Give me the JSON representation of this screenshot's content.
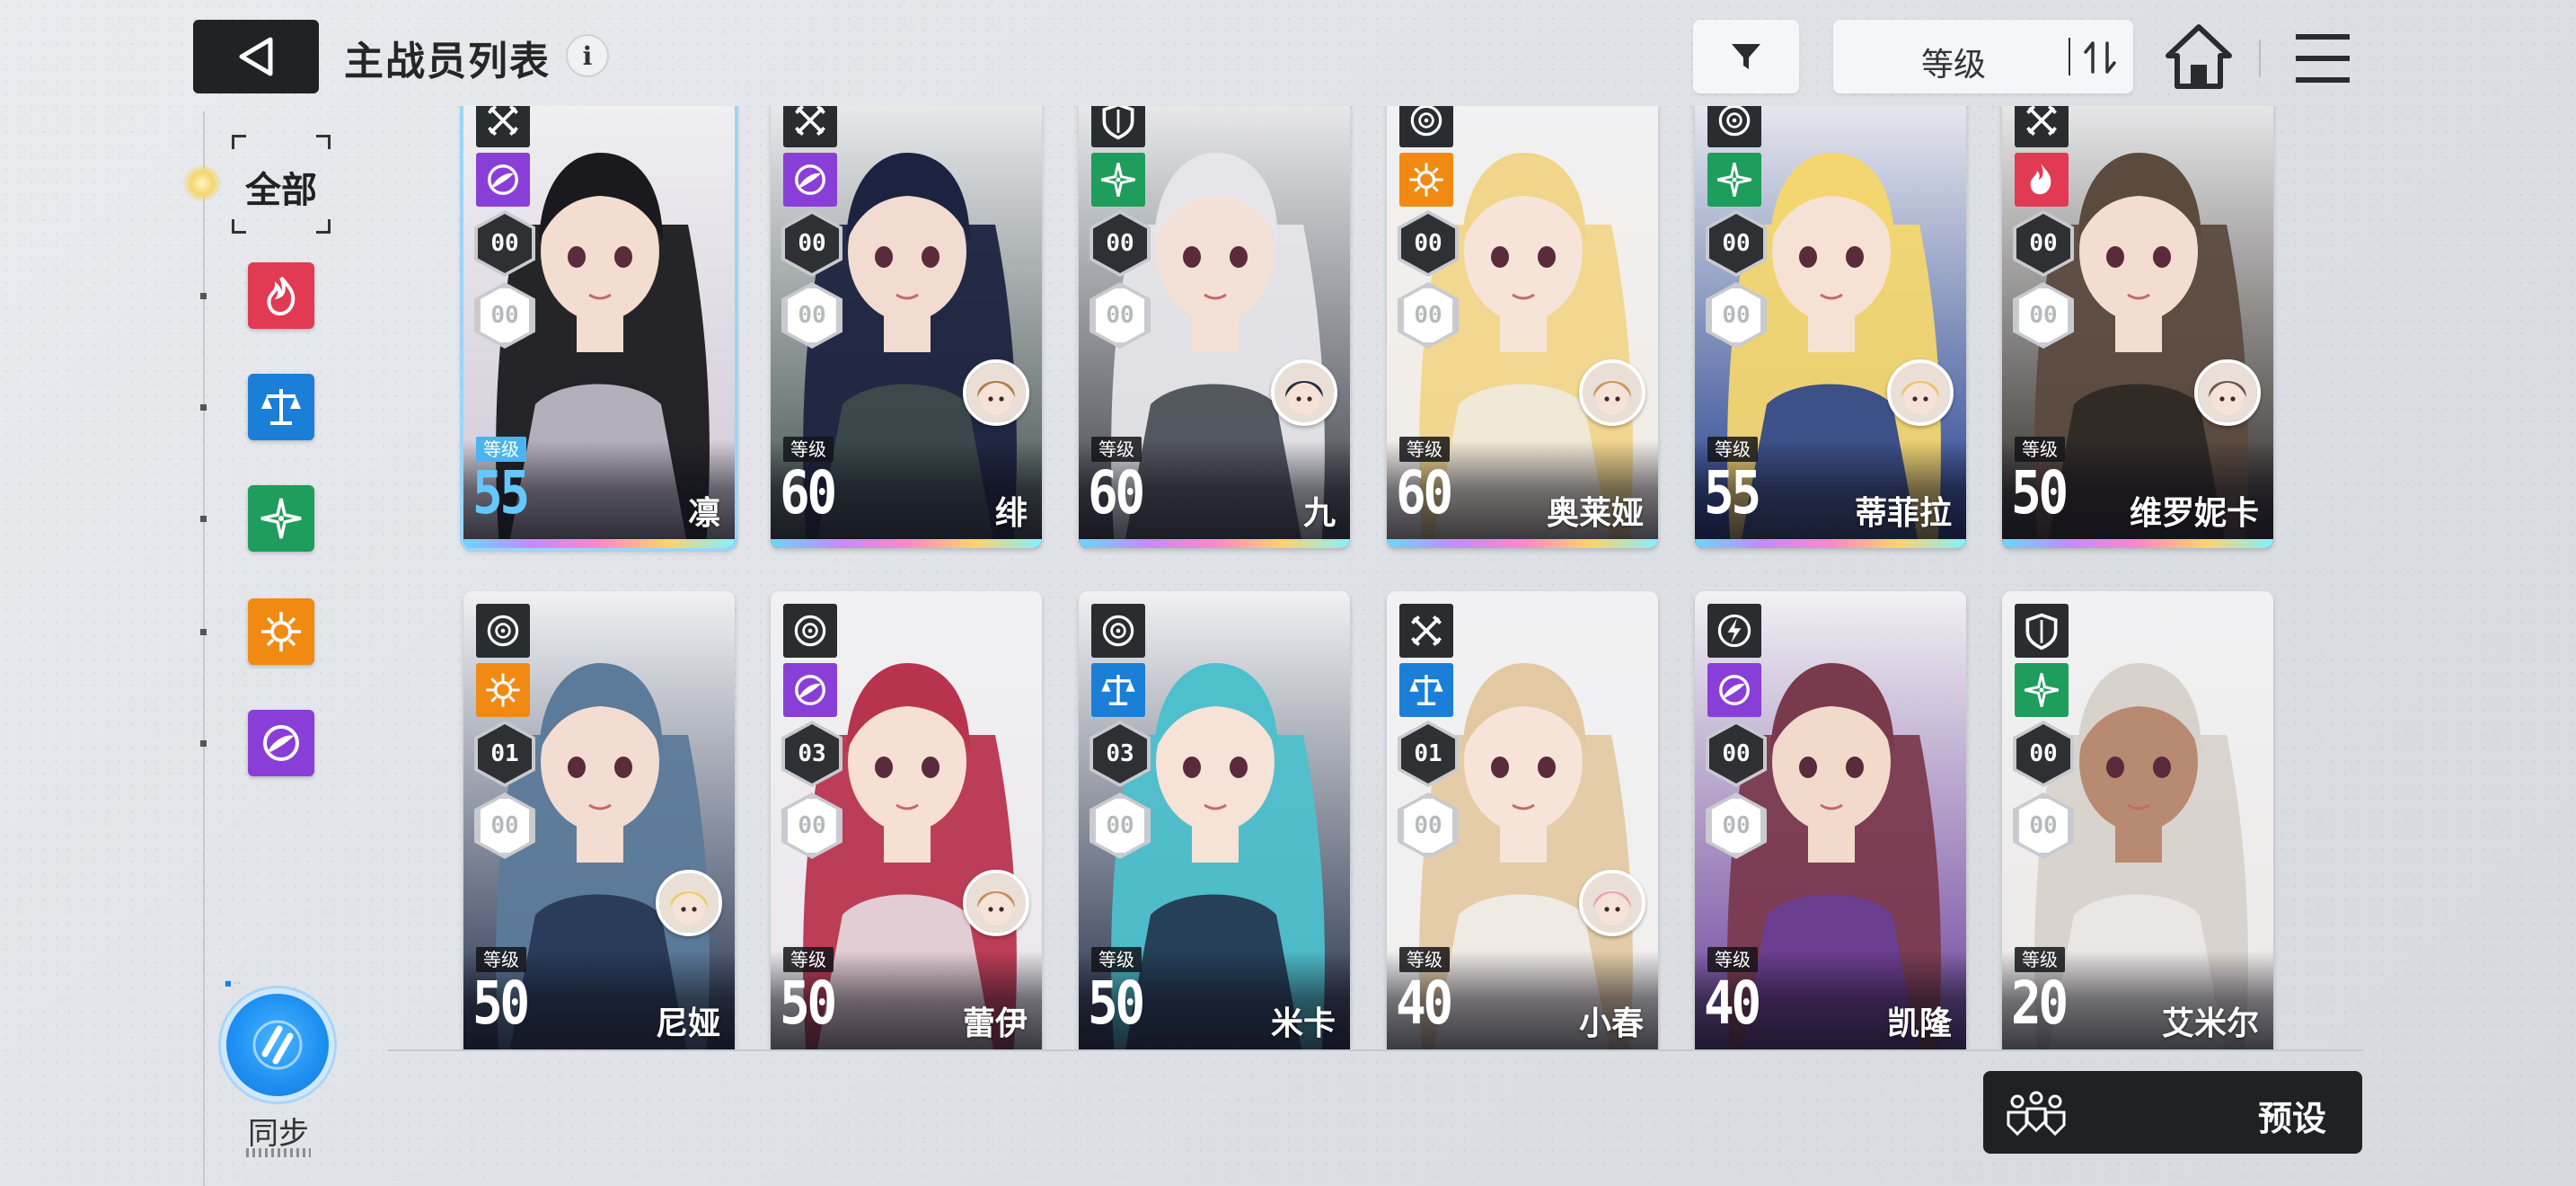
{
  "header": {
    "title": "主战员列表",
    "info_glyph": "i",
    "sort_label": "等级"
  },
  "sidebar": {
    "filter_all_label": "全部",
    "element_filters": [
      {
        "name": "fire",
        "color": "#e23a52"
      },
      {
        "name": "order",
        "color": "#1b7fd8"
      },
      {
        "name": "wind",
        "color": "#1f9d5c"
      },
      {
        "name": "light",
        "color": "#f08a12"
      },
      {
        "name": "void",
        "color": "#8a3ed8"
      }
    ],
    "sync_label": "同步"
  },
  "level_tag": "等级",
  "cards": [
    {
      "name": "凛",
      "level": "55",
      "class": "sword",
      "element": "void",
      "rank_top": "00",
      "rank_bottom": "00",
      "selected": true,
      "hair": "#1a1a1e",
      "skin": "#f3dcd0",
      "bg": "#cfc8d6",
      "has_avatar": false
    },
    {
      "name": "绯",
      "level": "60",
      "class": "sword",
      "element": "void",
      "rank_top": "00",
      "rank_bottom": "00",
      "selected": false,
      "hair": "#1c2340",
      "skin": "#f2dbd0",
      "bg": "#3f4f4c",
      "has_avatar": true,
      "avatar_hair": "#b07a4c"
    },
    {
      "name": "九",
      "level": "60",
      "class": "shield",
      "element": "wind",
      "rank_top": "00",
      "rank_bottom": "00",
      "selected": false,
      "hair": "#e6e6ea",
      "skin": "#f3e0d6",
      "bg": "#3b3f48",
      "has_avatar": true,
      "avatar_hair": "#222a44"
    },
    {
      "name": "奥莱娅",
      "level": "60",
      "class": "target",
      "element": "light",
      "rank_top": "00",
      "rank_bottom": "00",
      "selected": false,
      "hair": "#f0d58a",
      "skin": "#f6e4d8",
      "bg": "#f1ece4",
      "has_avatar": true,
      "avatar_hair": "#c89a5a"
    },
    {
      "name": "蒂菲拉",
      "level": "55",
      "class": "target",
      "element": "wind",
      "rank_top": "00",
      "rank_bottom": "00",
      "selected": false,
      "hair": "#f3d670",
      "skin": "#f6e2d4",
      "bg": "#1f3b8c",
      "has_avatar": true,
      "avatar_hair": "#e9c56a"
    },
    {
      "name": "维罗妮卡",
      "level": "50",
      "class": "sword",
      "element": "fire",
      "rank_top": "00",
      "rank_bottom": "00",
      "selected": false,
      "hair": "#5b4a3e",
      "skin": "#f3ddd0",
      "bg": "#2a2622",
      "has_avatar": true,
      "avatar_hair": "#6a5a4c"
    },
    {
      "name": "尼娅",
      "level": "50",
      "class": "target",
      "element": "light",
      "rank_top": "01",
      "rank_bottom": "00",
      "selected": false,
      "hair": "#5c7a9a",
      "skin": "#f3ddd2",
      "bg": "#22314f",
      "has_avatar": true,
      "avatar_hair": "#e8cf6a"
    },
    {
      "name": "蕾伊",
      "level": "50",
      "class": "target",
      "element": "void",
      "rank_top": "03",
      "rank_bottom": "00",
      "selected": false,
      "hair": "#b8344e",
      "skin": "#f6e0d4",
      "bg": "#e9e6ea",
      "has_avatar": true,
      "avatar_hair": "#c6905a"
    },
    {
      "name": "米卡",
      "level": "50",
      "class": "target",
      "element": "order",
      "rank_top": "03",
      "rank_bottom": "00",
      "selected": false,
      "hair": "#4ec0cc",
      "skin": "#f6e2d6",
      "bg": "#1e2a44",
      "has_avatar": false
    },
    {
      "name": "小春",
      "level": "40",
      "class": "sword",
      "element": "order",
      "rank_top": "01",
      "rank_bottom": "00",
      "selected": false,
      "hair": "#e2c9a2",
      "skin": "#f7e4d8",
      "bg": "#f1efee",
      "has_avatar": true,
      "avatar_hair": "#f0a0b4"
    },
    {
      "name": "凯隆",
      "level": "40",
      "class": "bolt",
      "element": "void",
      "rank_top": "00",
      "rank_bottom": "00",
      "selected": false,
      "hair": "#7a3a4e",
      "skin": "#f1d9cc",
      "bg": "#6a3e9a",
      "has_avatar": false
    },
    {
      "name": "艾米尔",
      "level": "20",
      "class": "shield",
      "element": "wind",
      "rank_top": "00",
      "rank_bottom": "00",
      "selected": false,
      "hair": "#d7d2cc",
      "skin": "#b98a72",
      "bg": "#ece9e6",
      "has_avatar": false
    }
  ],
  "element_colors": {
    "fire": "#e23a52",
    "order": "#1b7fd8",
    "wind": "#1f9d5c",
    "light": "#f08a12",
    "void": "#8a3ed8"
  },
  "preset": {
    "label": "预设"
  }
}
